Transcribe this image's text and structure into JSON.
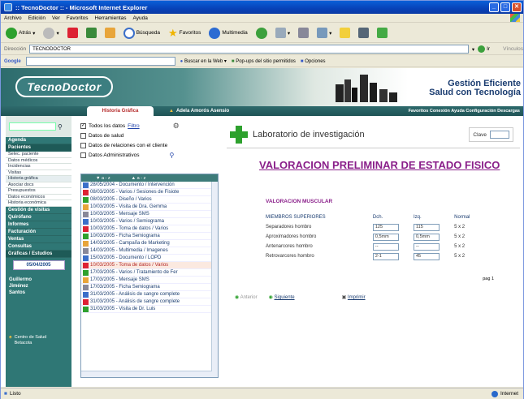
{
  "window": {
    "title": ":: TecnoDoctor :: - Microsoft Internet Explorer"
  },
  "menubar": [
    "Archivo",
    "Edición",
    "Ver",
    "Favoritos",
    "Herramientas",
    "Ayuda"
  ],
  "toolbar": {
    "back": "Atrás",
    "search": "Búsqueda",
    "favorites": "Favoritos",
    "media": "Multimedia"
  },
  "address": {
    "label": "Dirección",
    "value": "TECNODOCTOR",
    "go": "Ir",
    "links": "Vínculos"
  },
  "googlebar": {
    "brand": "Google",
    "search_web": "Buscar en la Web",
    "popups": "Pop-ups del sitio permitidos",
    "options": "Opciones"
  },
  "site": {
    "logo": "TecnoDoctor",
    "slogan_line1": "Gestión Eficiente",
    "slogan_line2": "Salud con Tecnología",
    "tab_active": "Historia Gráfica",
    "patient": "Adela  Amorós Asensio",
    "top_links": "Favoritos Conexión Ayuda Configuración Descargas"
  },
  "sidebar": {
    "sections": [
      {
        "label": "Agenda"
      },
      {
        "label": "Pacientes",
        "items": [
          "Selec. paciente",
          "Datos médicos",
          "Incidencias",
          "Visitas",
          "Historia gráfica",
          "Asociar docs",
          "Presupuestos",
          "Datos económicos",
          "Historia económica"
        ]
      },
      {
        "label": "Gestión de visitas"
      },
      {
        "label": "Quirófano"
      },
      {
        "label": "Informes"
      },
      {
        "label": "Facturación"
      },
      {
        "label": "Ventas"
      },
      {
        "label": "Consultas"
      },
      {
        "label": "Gráficas / Estudios"
      }
    ],
    "date": "05/04/2005",
    "user_line1": "Guillermo",
    "user_line2": "Jiménez",
    "user_line3": "Santos",
    "footer_line1": "Centro de Salud",
    "footer_line2": "Betacota"
  },
  "filters": {
    "all": "Todos los datos",
    "filter_link": "Filtro",
    "health": "Datos de salud",
    "client": "Datos de relaciones con el cliente",
    "admin": "Datos Administrativos"
  },
  "doc_list": {
    "col1": "▼ a - z",
    "col2": "▲ a - z",
    "items": [
      "28/05/2004 - Documento / Intervención",
      "08/03/2005 - Varios / Sesiones de Fisiote",
      "08/03/2005 - Diseño / Varios",
      "10/03/2005 - Visita de Dra. Gemma",
      "10/03/2005 - Mensaje SMS",
      "10/03/2005 - Varios / Semiograma",
      "10/03/2005 - Toma de datos / Varios",
      "10/03/2005 - Ficha Semiograma",
      "14/03/2005 - Campaña de Marketing",
      "14/03/2005 - Multimedia / Imagenes",
      "15/03/2005 - Documento / LOPD",
      "10/03/2005 - Toma de datos / Varios",
      "17/03/2005 - Varios / Tratamiento de Fer",
      "17/03/2005 - Mensaje SMS",
      "17/03/2005 - Ficha Semiograma",
      "31/03/2005 - Análisis de sangre complete",
      "31/03/2005 - Análisis de sangre complete",
      "31/03/2005 - Visita de Dr. Luis"
    ],
    "selected_index": 11
  },
  "report": {
    "lab": "Laboratorio de investigación",
    "clave": "Clave",
    "title": "VALORACION PRELIMINAR DE ESTADO FISICO",
    "section": "VALORACION MUSCULAR",
    "headers": [
      "MIEMBROS SUPERIORES",
      "Dch.",
      "Izq.",
      "Normal"
    ],
    "rows": [
      {
        "label": "Separadores hombro",
        "d": "125",
        "i": "115",
        "n": "5 x 2"
      },
      {
        "label": "Aproximadores hombro",
        "d": "0,5mm",
        "i": "0,5mm",
        "n": "5 x 2"
      },
      {
        "label": "Antenarcores hombro",
        "d": "--",
        "i": "--",
        "n": "5 x 2"
      },
      {
        "label": "Retrovarcores hombro",
        "d": "2-1",
        "i": "45",
        "n": "5 x 2"
      }
    ],
    "page": "pag 1",
    "prev": "Anterior",
    "next": "Siguiente",
    "print": "Imprimir"
  },
  "status": {
    "left": "Listo",
    "zone": "Internet"
  }
}
